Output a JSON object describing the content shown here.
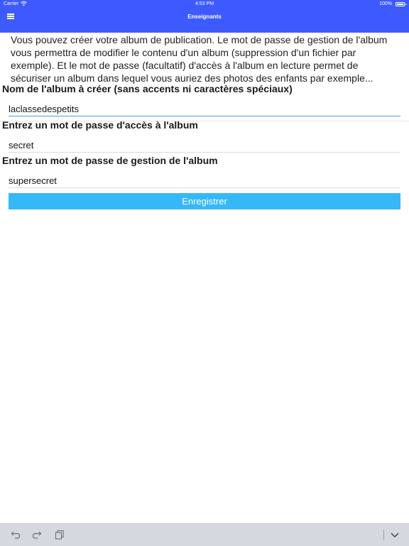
{
  "status_bar": {
    "carrier": "Carrier",
    "time": "4:53 PM",
    "battery": "100%"
  },
  "nav": {
    "title": "Enseignants",
    "menu_icon": "hamburger-menu-icon"
  },
  "intro_text": "Vous pouvez créer votre album de publication. Le mot de passe de gestion de l'album vous permettra de modifier le contenu d'un album (suppression d'un fichier par exemple). Et le mot de passe (facultatif) d'accès à l'album en lecture permet de sécuriser un album dans lequel vous auriez des photos des enfants par exemple...",
  "form": {
    "album_name_label": "Nom de l'album à créer (sans accents ni caractères spéciaux)",
    "album_name_value": "laclassedespetits",
    "read_password_label": "Entrez un mot de passe d'accès à l'album",
    "read_password_value": "secret",
    "manage_password_label": "Entrez un mot de passe de gestion de l'album",
    "manage_password_value": "supersecret",
    "save_label": "Enregistrer"
  },
  "colors": {
    "nav_background": "#3d5afe",
    "button_background": "#35b8f7",
    "active_underline": "#38a7d6"
  },
  "keyboard_bar": {
    "icons": [
      "undo-icon",
      "redo-icon",
      "paste-icon",
      "dismiss-keyboard-icon"
    ]
  }
}
